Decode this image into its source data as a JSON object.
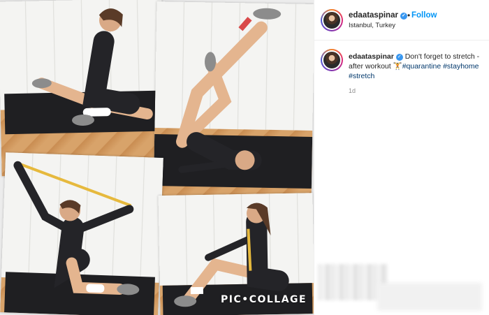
{
  "post": {
    "username": "edaataspinar",
    "verified": "✓",
    "separator": "•",
    "follow_label": "Follow",
    "location": "Istanbul, Turkey"
  },
  "caption": {
    "username": "edaataspinar",
    "text": "Don't forget to stretch - after workout",
    "emoji": "🏋",
    "hashtags": [
      "#quarantine",
      "#stayhome",
      "#stretch"
    ],
    "time": "1d"
  },
  "collage": {
    "watermark": "PIC•COLLAGE"
  },
  "colors": {
    "link": "#0095f6",
    "hashtag": "#00376b",
    "verified": "#3897f0"
  }
}
